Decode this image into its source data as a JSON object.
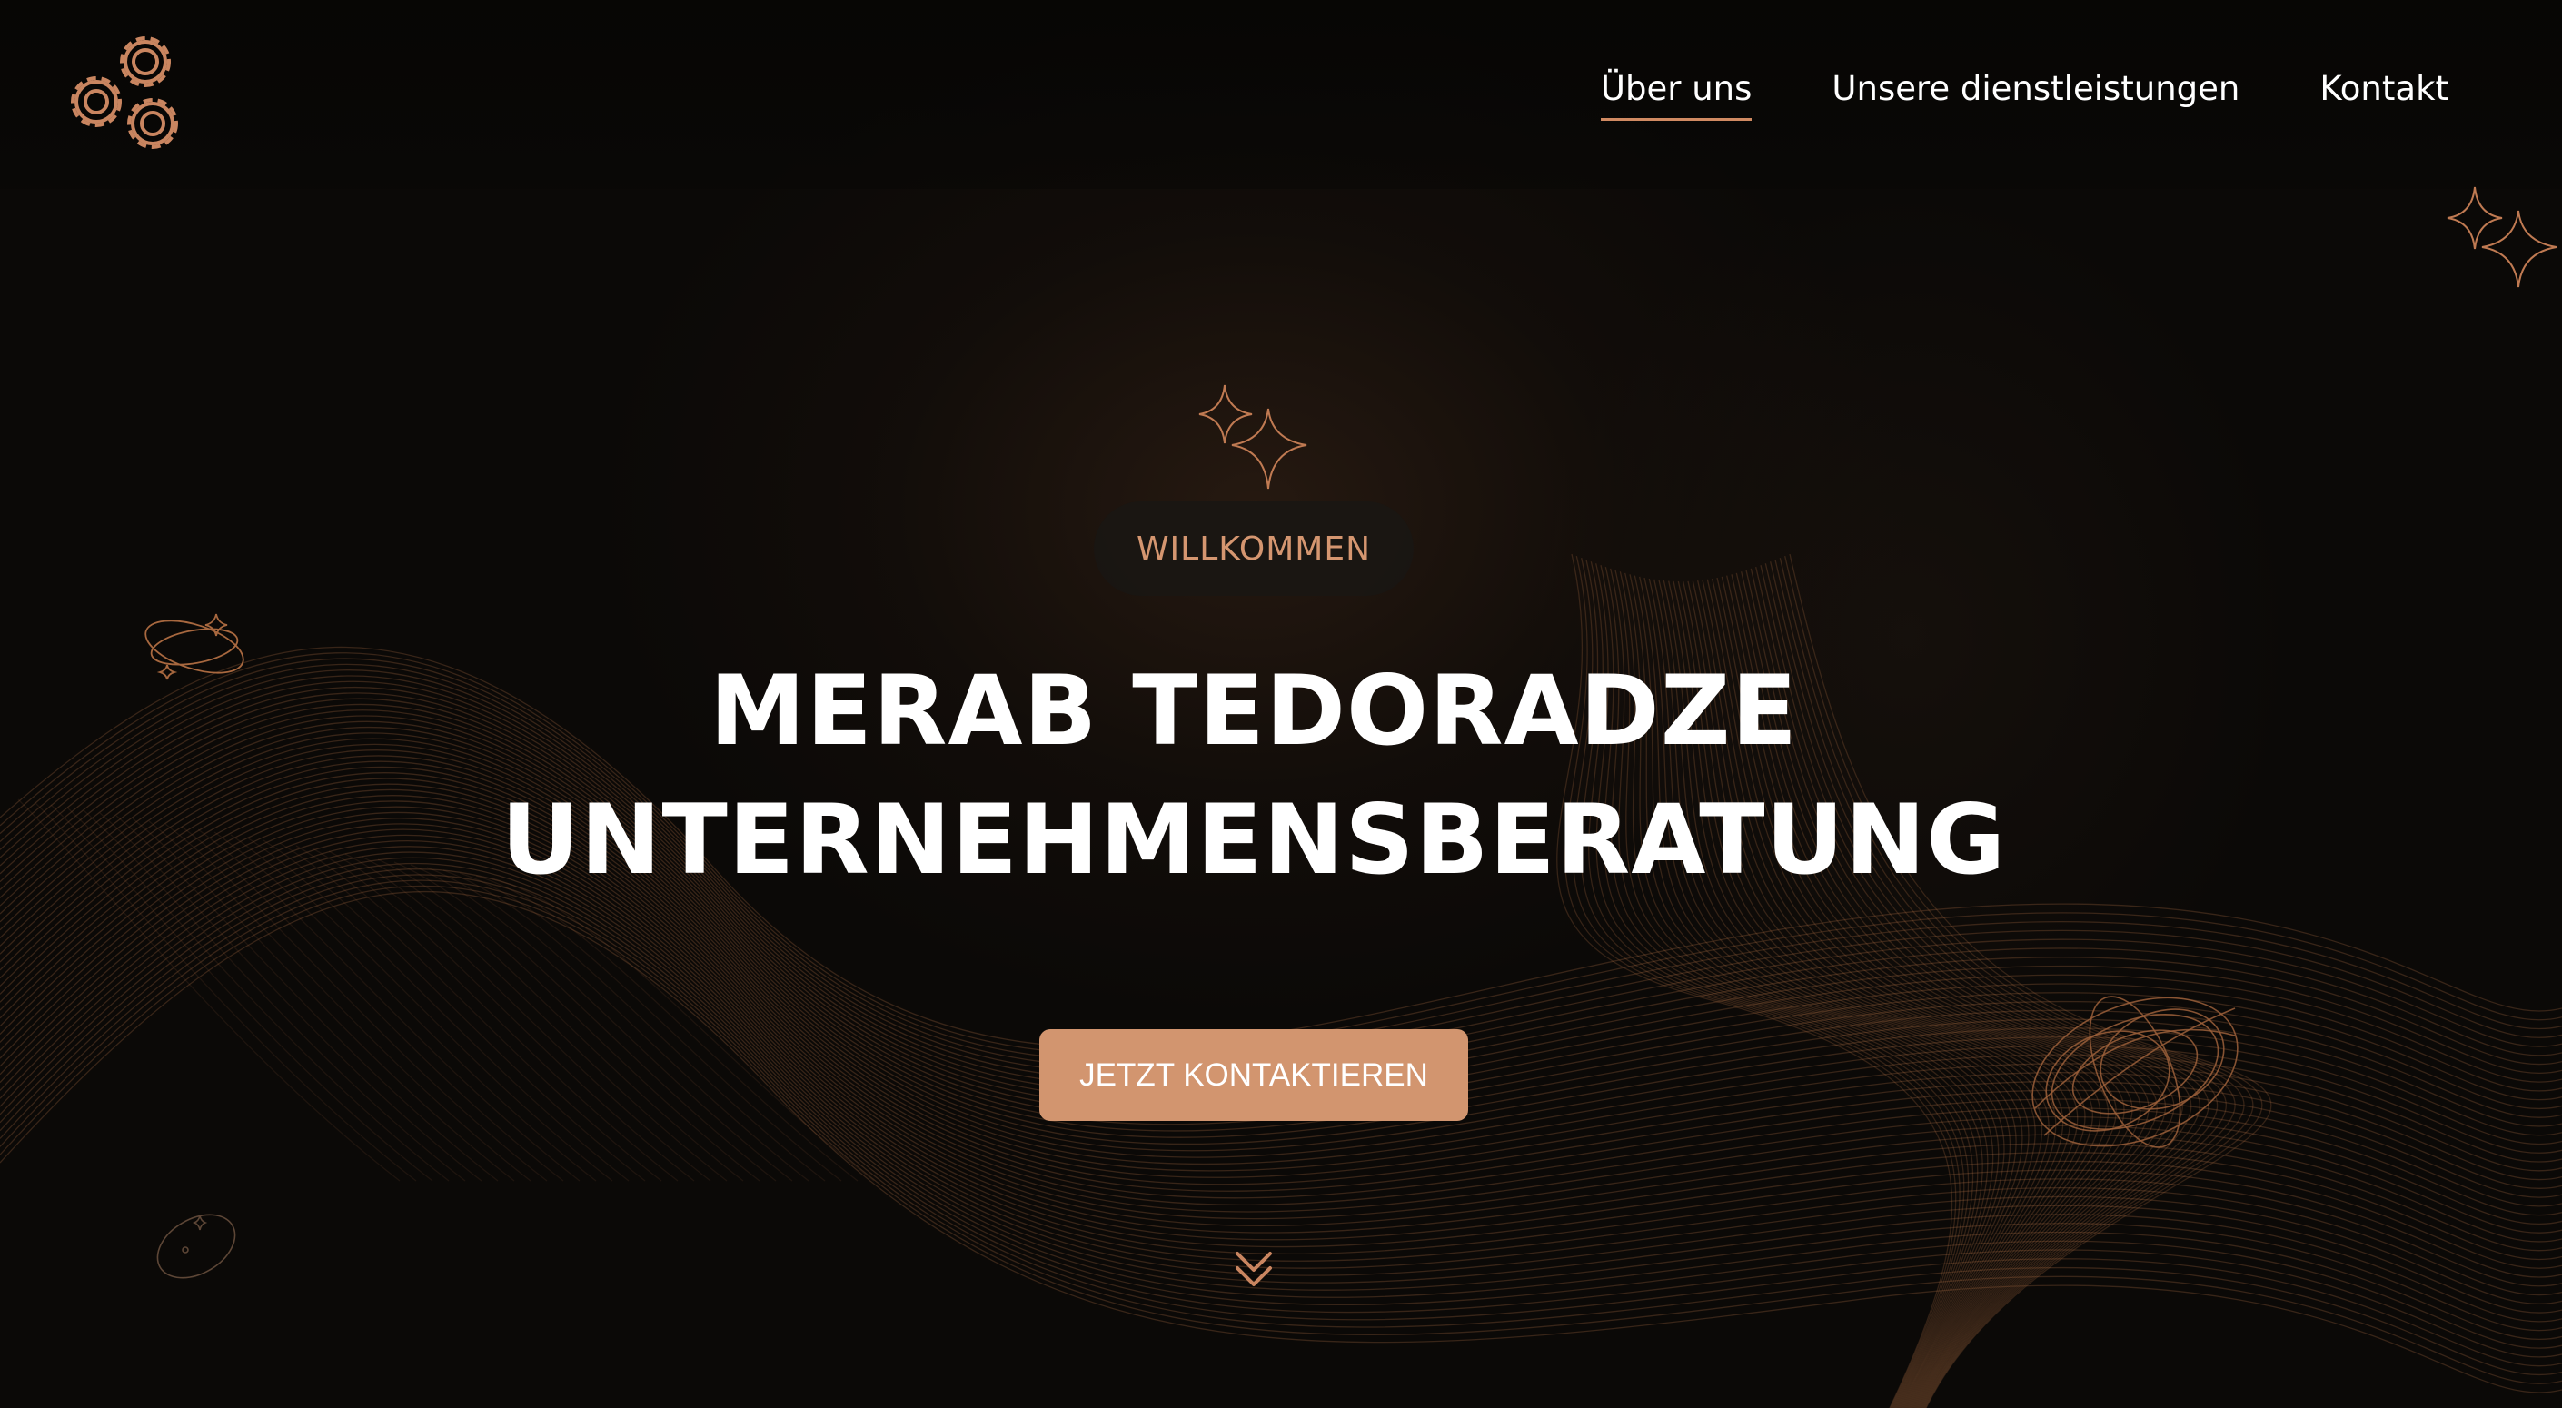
{
  "header": {
    "nav": [
      {
        "label": "Über uns",
        "active": true
      },
      {
        "label": "Unsere dienstleistungen",
        "active": false
      },
      {
        "label": "Kontakt",
        "active": false
      }
    ]
  },
  "hero": {
    "badge": "WILLKOMMEN",
    "title_line1": "MERAB TEDORADZE",
    "title_line2": "UNTERNEHMENSBERATUNG",
    "cta_label": "JETZT KONTAKTIEREN"
  },
  "icons": {
    "logo": "gears-icon",
    "scroll": "double-chevron-down-icon",
    "decorations": [
      "sparkle-icon",
      "orbit-icon",
      "wireframe-torus-icon"
    ]
  },
  "colors": {
    "background": "#0b0907",
    "accent": "#d2956f",
    "badge_text": "#d59670",
    "text": "#ffffff"
  }
}
